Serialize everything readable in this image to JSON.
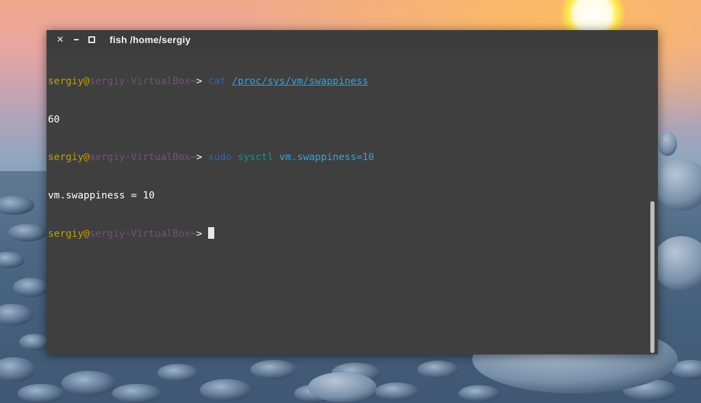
{
  "window": {
    "title": "fish /home/sergiy",
    "title_app": "fish",
    "title_path": "/home/sergiy",
    "buttons": {
      "close": "✕",
      "minimize": "minimize-icon",
      "maximize": "maximize-icon"
    }
  },
  "prompt": {
    "user": "sergiy",
    "at": "@",
    "host": "sergiy-VirtualBox",
    "tilde": "~",
    "arrow": "> "
  },
  "lines": [
    {
      "type": "prompt",
      "command": "cat",
      "args": "/proc/sys/vm/swappiness"
    },
    {
      "type": "output",
      "text": "60"
    },
    {
      "type": "prompt",
      "command": "sudo",
      "command2": "sysctl",
      "args": "vm.swappiness=10"
    },
    {
      "type": "output",
      "text": "vm.swappiness = 10"
    },
    {
      "type": "prompt",
      "command": "",
      "args": ""
    }
  ],
  "colors": {
    "user": "#c4a000",
    "host": "#75507b",
    "command": "#3465a4",
    "argument": "#34a2e2",
    "background": "#3f3f3f"
  }
}
